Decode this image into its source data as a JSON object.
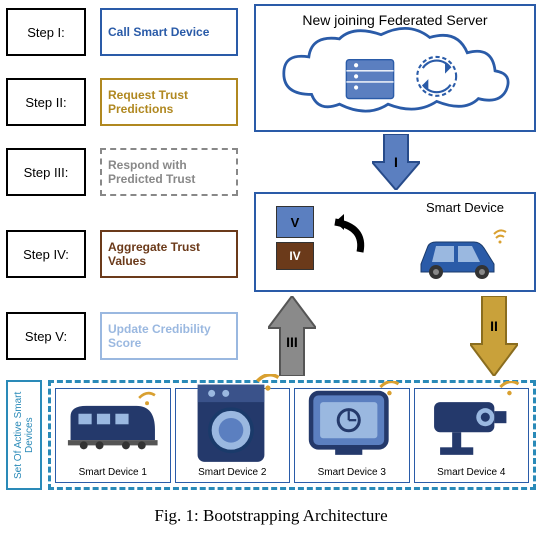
{
  "steps": {
    "s1": {
      "label": "Step I:",
      "desc": "Call Smart Device"
    },
    "s2": {
      "label": "Step II:",
      "desc": "Request Trust Predictions"
    },
    "s3": {
      "label": "Step III:",
      "desc": "Respond with Predicted Trust"
    },
    "s4": {
      "label": "Step IV:",
      "desc": "Aggregate Trust Values"
    },
    "s5": {
      "label": "Step V:",
      "desc": "Update Credibility Score"
    }
  },
  "fedServer": {
    "title": "New joining Federated Server"
  },
  "smartDevice": {
    "title": "Smart Device",
    "boxV": "V",
    "boxIV": "IV"
  },
  "arrows": {
    "i": "I",
    "ii": "II",
    "iii": "III"
  },
  "activeLabel": "Set Of Active Smart Devices",
  "devices": {
    "d1": "Smart Device 1",
    "d2": "Smart Device 2",
    "d3": "Smart Device 3",
    "d4": "Smart Device 4"
  },
  "caption": "Fig. 1: Bootstrapping Architecture"
}
